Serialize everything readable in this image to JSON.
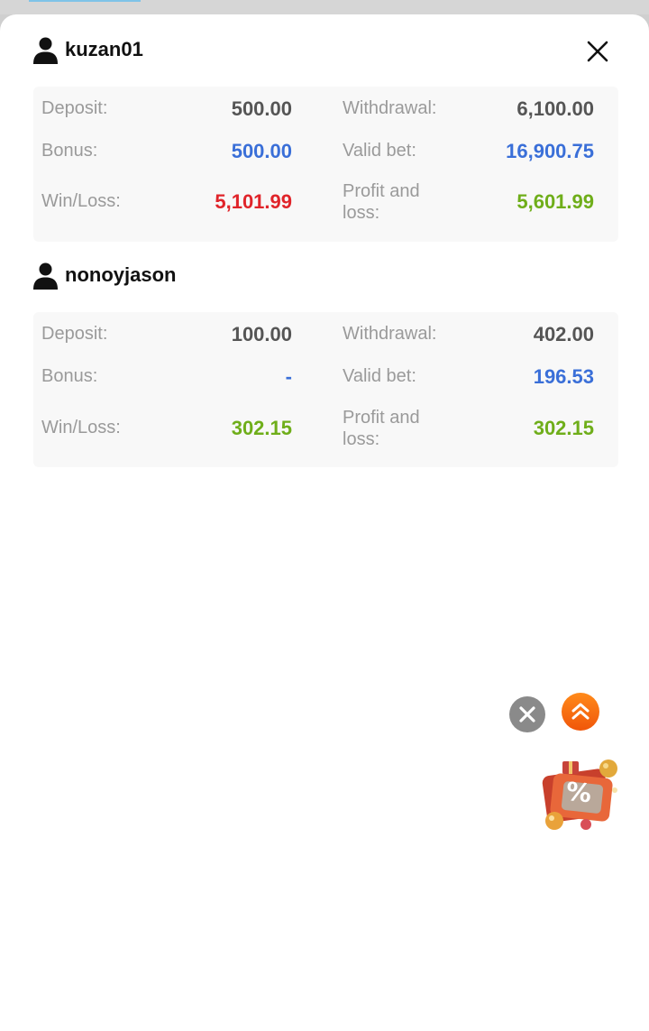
{
  "colors": {
    "blue": "#3a6fd8",
    "red": "#e0242a",
    "green": "#6fae1a",
    "dark": "#555555"
  },
  "close_icon": "close-icon",
  "users": [
    {
      "name": "kuzan01",
      "deposit_label": "Deposit:",
      "deposit": "500.00",
      "withdrawal_label": "Withdrawal:",
      "withdrawal": "6,100.00",
      "bonus_label": "Bonus:",
      "bonus": "500.00",
      "valid_bet_label": "Valid bet:",
      "valid_bet": "16,900.75",
      "winloss_label": "Win/Loss:",
      "winloss": "5,101.99",
      "profit_label_1": "Profit and",
      "profit_label_2": "loss:",
      "profit": "5,601.99"
    },
    {
      "name": "nonoyjason",
      "deposit_label": "Deposit:",
      "deposit": "100.00",
      "withdrawal_label": "Withdrawal:",
      "withdrawal": "402.00",
      "bonus_label": "Bonus:",
      "bonus": "-",
      "valid_bet_label": "Valid bet:",
      "valid_bet": "196.53",
      "winloss_label": "Win/Loss:",
      "winloss": "302.15",
      "profit_label_1": "Profit and",
      "profit_label_2": "loss:",
      "profit": "302.15"
    }
  ],
  "floating": {
    "dismiss_icon": "close-circle-icon",
    "scroll_top_icon": "double-chevron-up-icon",
    "promo_badge": "%"
  }
}
